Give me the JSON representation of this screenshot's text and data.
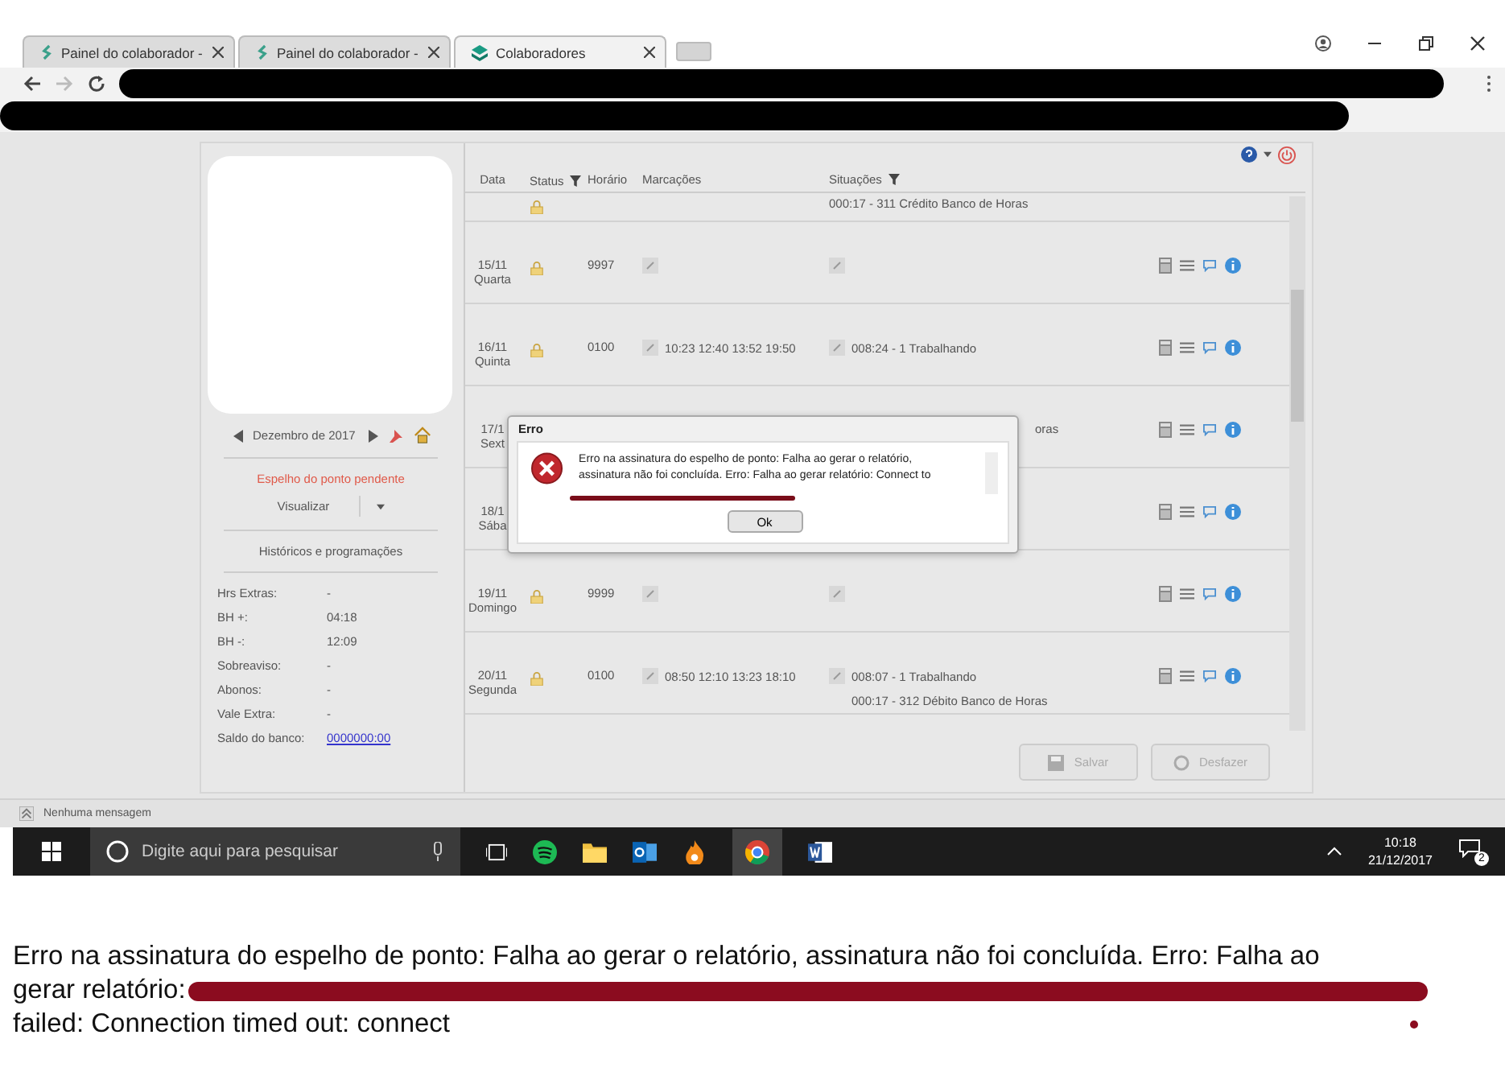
{
  "browser": {
    "tabs": [
      {
        "title": "Painel do colaborador -",
        "selected": false
      },
      {
        "title": "Painel do colaborador -",
        "selected": false
      },
      {
        "title": "Colaboradores",
        "selected": true
      }
    ]
  },
  "sidebar": {
    "month": "Dezembro de 2017",
    "pending": "Espelho do ponto pendente",
    "view_button": "Visualizar",
    "history_link": "Históricos e programações",
    "stats": [
      {
        "label": "Hrs Extras:",
        "value": "-",
        "kind": "text"
      },
      {
        "label": "BH +:",
        "value": "04:18",
        "kind": "text"
      },
      {
        "label": "BH -:",
        "value": "12:09",
        "kind": "text"
      },
      {
        "label": "Sobreaviso:",
        "value": "-",
        "kind": "text"
      },
      {
        "label": "Abonos:",
        "value": "-",
        "kind": "text"
      },
      {
        "label": "Vale Extra:",
        "value": "-",
        "kind": "text"
      },
      {
        "label": "Saldo do banco:",
        "value": "0000000:00",
        "kind": "link"
      }
    ]
  },
  "table": {
    "columns": [
      {
        "label": "Data",
        "kind": "plain"
      },
      {
        "label": "Status",
        "kind": "filter"
      },
      {
        "label": "Horário",
        "kind": "plain"
      },
      {
        "label": "Marcações",
        "kind": "plain"
      },
      {
        "label": "Situações",
        "kind": "filter"
      }
    ],
    "rows": [
      {
        "kind": "top",
        "situations": [
          "000:17 - 311 Crédito Banco de Horas"
        ]
      },
      {
        "kind": "day",
        "date": "15/11",
        "day": "Quarta",
        "schedule": "9997"
      },
      {
        "kind": "day",
        "date": "16/11",
        "day": "Quinta",
        "schedule": "0100",
        "punches": "10:23 12:40 13:52 19:50",
        "situations": [
          "008:24 - 1 Trabalhando"
        ]
      },
      {
        "kind": "covered",
        "date": "17/1",
        "day": "Sext",
        "situation_tail": "oras"
      },
      {
        "kind": "covered",
        "date": "18/1",
        "day": "Sába"
      },
      {
        "kind": "day",
        "date": "19/11",
        "day": "Domingo",
        "schedule": "9999"
      },
      {
        "kind": "day",
        "date": "20/11",
        "day": "Segunda",
        "schedule": "0100",
        "punches": "08:50 12:10 13:23 18:10",
        "situations": [
          "008:07 - 1 Trabalhando",
          "000:17 - 312 Débito Banco de Horas"
        ]
      }
    ]
  },
  "buttons": [
    {
      "label": "Salvar",
      "disabled": true
    },
    {
      "label": "Desfazer",
      "disabled": true
    }
  ],
  "dialog": {
    "title": "Erro",
    "message": "Erro na assinatura do espelho de ponto: Falha ao gerar o relatório, assinatura não foi concluída. Erro: Falha ao gerar relatório: Connect to",
    "button": "Ok"
  },
  "status_bar": {
    "message": "Nenhuma mensagem"
  },
  "taskbar": {
    "search_placeholder": "Digite aqui para pesquisar",
    "time": "10:18",
    "date": "21/12/2017",
    "notifications": "2"
  },
  "caption": {
    "lines": [
      "Erro na assinatura do espelho de ponto: Falha ao gerar o relatório, assinatura não foi concluída. Erro: Falha ao",
      "gerar relatório:",
      "failed: Connection timed out: connect"
    ]
  }
}
